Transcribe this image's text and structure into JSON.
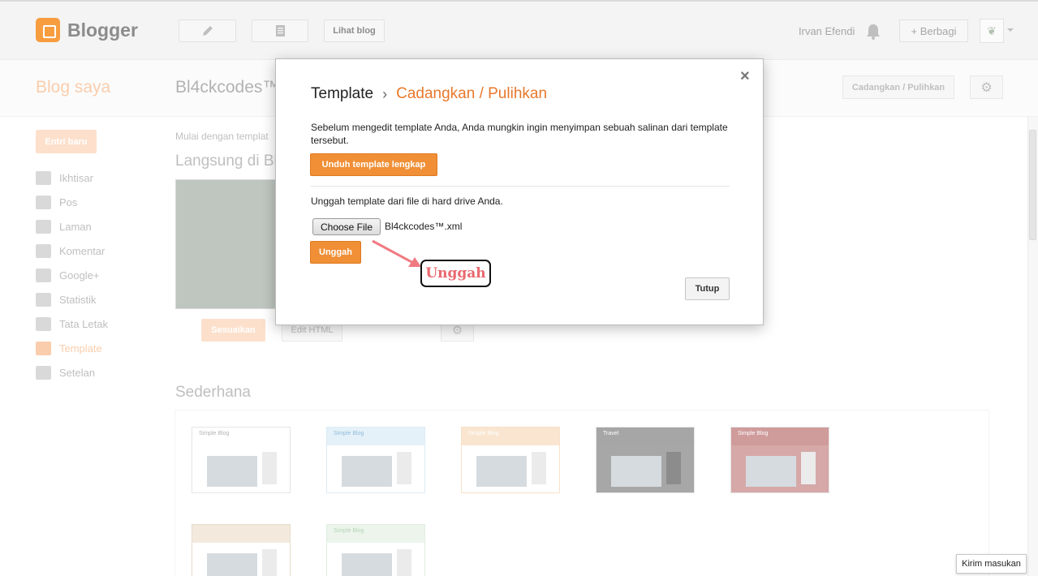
{
  "header": {
    "app_name": "Blogger",
    "view_blog": "Lihat blog",
    "user_name": "Irvan Efendi",
    "share": "+ Berbagi"
  },
  "subheader": {
    "my_blogs": "Blog saya",
    "blog_name": "Bl4ckcodes™",
    "backup_restore": "Cadangkan / Pulihkan"
  },
  "sidebar": {
    "new_post": "Entri baru",
    "items": [
      {
        "label": "Ikhtisar",
        "icon": "home-icon"
      },
      {
        "label": "Pos",
        "icon": "posts-icon"
      },
      {
        "label": "Laman",
        "icon": "pages-icon"
      },
      {
        "label": "Komentar",
        "icon": "comments-icon"
      },
      {
        "label": "Google+",
        "icon": "google-plus-icon"
      },
      {
        "label": "Statistik",
        "icon": "stats-icon"
      },
      {
        "label": "Tata Letak",
        "icon": "layout-icon"
      },
      {
        "label": "Template",
        "icon": "template-icon",
        "active": true
      },
      {
        "label": "Setelan",
        "icon": "settings-wrench-icon"
      }
    ]
  },
  "main": {
    "intro": "Mulai dengan templat",
    "live_heading": "Langsung di Bl",
    "customize": "Sesuaikan",
    "edit_html": "Edit HTML",
    "simple_heading": "Sederhana",
    "thumb_label": "Simple Blog",
    "thumb_label_travel": "Travel"
  },
  "dialog": {
    "title": "Template",
    "separator": "›",
    "subtitle": "Cadangkan / Pulihkan",
    "backup_desc": "Sebelum mengedit template Anda, Anda mungkin ingin menyimpan sebuah salinan dari template tersebut.",
    "download_button": "Unduh template lengkap",
    "upload_desc": "Unggah template dari file di hard drive Anda.",
    "choose_file": "Choose File",
    "file_name": "Bl4ckcodes™.xml",
    "upload_button": "Unggah",
    "close_button": "Tutup",
    "close_icon": "×"
  },
  "annotation": {
    "label": "Unggah",
    "color": "#e9686f"
  },
  "feedback": "Kirim masukan",
  "colors": {
    "accent": "#f08f36",
    "subtitle": "#e8782c"
  }
}
